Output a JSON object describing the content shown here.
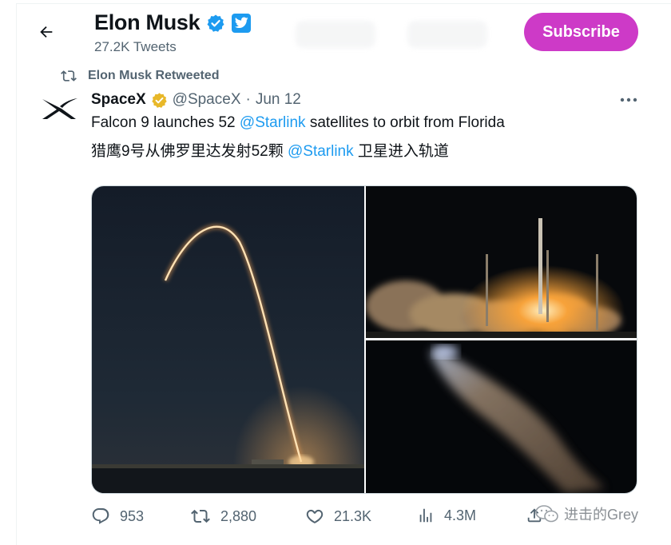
{
  "header": {
    "display_name": "Elon Musk",
    "tweet_count": "27.2K Tweets",
    "subscribe_label": "Subscribe"
  },
  "retweet": {
    "label": "Elon Musk Retweeted"
  },
  "tweet": {
    "author_name": "SpaceX",
    "handle": "@SpaceX",
    "separator": "·",
    "date": "Jun 12",
    "line1_prefix": "Falcon 9 launches 52 ",
    "line1_mention": "@Starlink",
    "line1_suffix": " satellites to orbit from Florida",
    "line2_prefix": "猎鹰9号从佛罗里达发射52颗 ",
    "line2_mention": "@Starlink",
    "line2_suffix": " 卫星进入轨道"
  },
  "actions": {
    "replies": "953",
    "retweets": "2,880",
    "likes": "21.3K",
    "views": "4.3M"
  },
  "watermark": {
    "text": "进击的Grey"
  },
  "colors": {
    "accent": "#1d9bf0",
    "subscribe": "#cd3ac7",
    "verified_gold": "#e8b829",
    "muted": "#536471"
  },
  "icons": [
    "back-arrow-icon",
    "verified-badge-icon",
    "twitter-blue-icon",
    "retweet-icon",
    "spacex-logo",
    "gold-verified-icon",
    "more-options-icon",
    "reply-icon",
    "retweet-action-icon",
    "like-icon",
    "views-icon",
    "share-icon",
    "wechat-icon"
  ]
}
